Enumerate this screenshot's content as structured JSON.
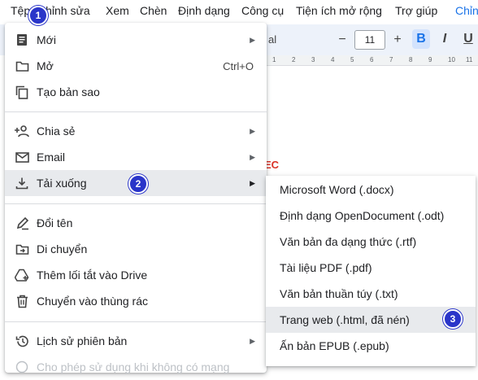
{
  "menubar": {
    "items": [
      "Tệp",
      "Chỉnh sửa",
      "Xem",
      "Chèn",
      "Định dạng",
      "Công cụ",
      "Tiện ích mở rộng",
      "Trợ giúp"
    ],
    "right_link": "Chỉn"
  },
  "toolbar": {
    "font_name": "al",
    "font_size": "11",
    "minus": "−",
    "plus": "+",
    "bold": "B",
    "italic": "I",
    "underline": "U"
  },
  "ruler": {
    "ticks": [
      "1",
      "2",
      "3",
      "4",
      "5",
      "6",
      "7",
      "8",
      "9",
      "10",
      "11"
    ]
  },
  "document": {
    "fragment": "EC"
  },
  "file_menu": {
    "new": "Mới",
    "open": "Mở",
    "open_shortcut": "Ctrl+O",
    "copy": "Tạo bản sao",
    "share": "Chia sẻ",
    "email": "Email",
    "download": "Tải xuống",
    "rename": "Đổi tên",
    "move": "Di chuyển",
    "shortcut": "Thêm lối tắt vào Drive",
    "trash": "Chuyển vào thùng rác",
    "history": "Lịch sử phiên bản",
    "offline": "Cho phép sử dụng khi không có mạng"
  },
  "download_submenu": {
    "items": [
      "Microsoft Word (.docx)",
      "Định dạng OpenDocument (.odt)",
      "Văn bản đa dạng thức (.rtf)",
      "Tài liệu PDF (.pdf)",
      "Văn bản thuần túy (.txt)",
      "Trang web (.html, đã nén)",
      "Ấn bản EPUB (.epub)"
    ],
    "highlighted_index": 5
  },
  "badges": {
    "step1": "1",
    "step2": "2",
    "step3": "3"
  },
  "colors": {
    "accent": "#1a73e8",
    "badge": "#2a35c9",
    "highlight": "#e8eaed"
  }
}
